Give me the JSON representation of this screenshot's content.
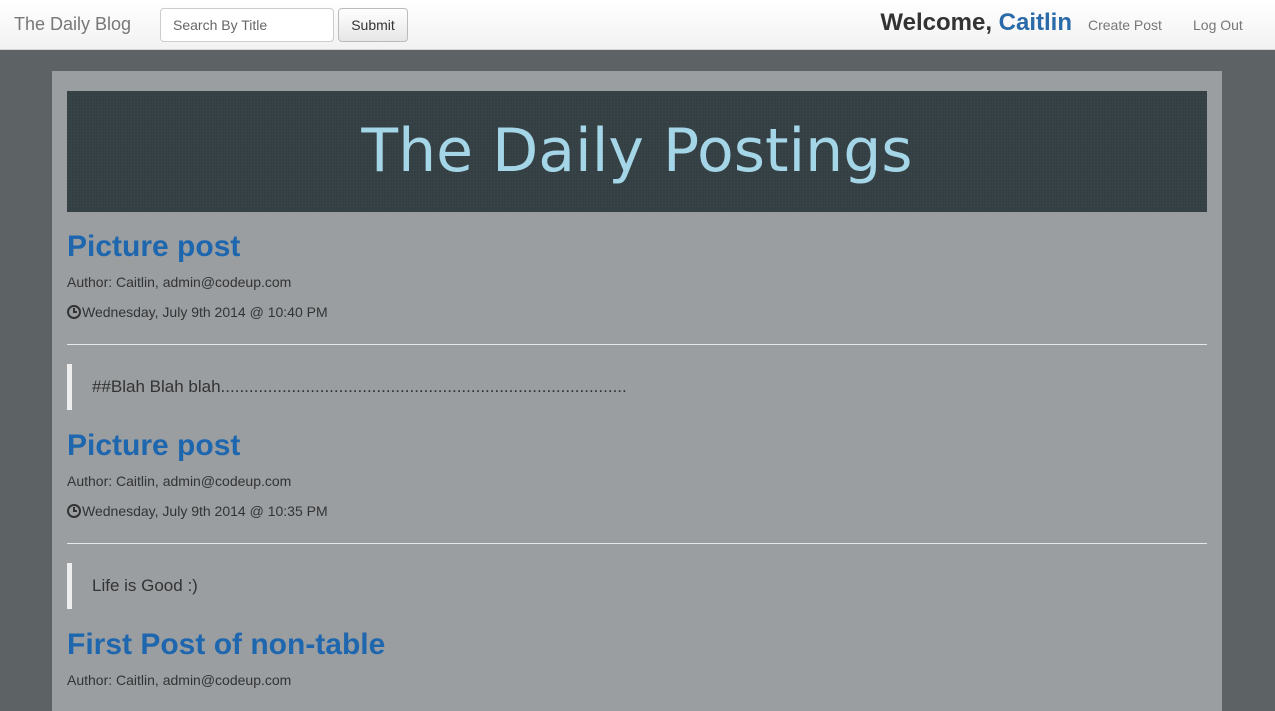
{
  "navbar": {
    "brand": "The Daily Blog",
    "search_placeholder": "Search By Title",
    "submit_label": "Submit",
    "welcome_prefix": "Welcome, ",
    "username": "Caitlin",
    "create_post_label": "Create Post",
    "logout_label": "Log Out"
  },
  "jumbotron": {
    "title": "The Daily Postings"
  },
  "posts": [
    {
      "title": "Picture post",
      "author": "Author: Caitlin, admin@codeup.com",
      "date": "Wednesday, July 9th 2014 @ 10:40 PM",
      "body": "##Blah Blah blah......................................................................................"
    },
    {
      "title": "Picture post",
      "author": "Author: Caitlin, admin@codeup.com",
      "date": "Wednesday, July 9th 2014 @ 10:35 PM",
      "body": "Life is Good :)"
    },
    {
      "title": "First Post of non-table",
      "author": "Author: Caitlin, admin@codeup.com"
    }
  ],
  "colors": {
    "page_background": "#5d6265",
    "content_background": "#9a9ea1",
    "jumbotron_background": "#343f44",
    "jumbotron_text": "#a4d6e8",
    "link_blue": "#1e67ae"
  },
  "icons": {
    "date": "clock-icon"
  }
}
